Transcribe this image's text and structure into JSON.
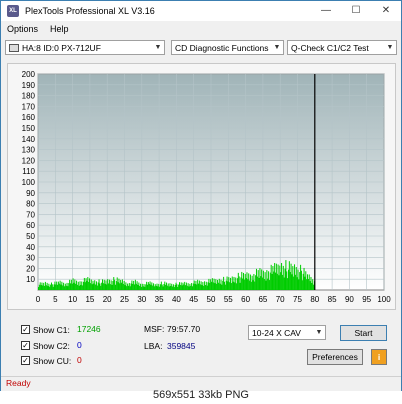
{
  "window": {
    "title": "PlexTools Professional XL V3.16",
    "icon_label": "XL",
    "controls": {
      "minimize": "—",
      "maximize": "☐",
      "close": "✕"
    }
  },
  "menu": {
    "options": "Options",
    "help": "Help"
  },
  "toolbar": {
    "drive": "HA:8 ID:0  PX-712UF",
    "function": "CD Diagnostic Functions",
    "test": "Q-Check C1/C2 Test"
  },
  "chart_data": {
    "type": "bar",
    "title": "",
    "xlabel": "",
    "ylabel": "",
    "xlim": [
      0,
      100
    ],
    "ylim": [
      0,
      200
    ],
    "x_ticks": [
      "0",
      "5",
      "10",
      "15",
      "20",
      "25",
      "30",
      "35",
      "40",
      "45",
      "50",
      "55",
      "60",
      "65",
      "70",
      "75",
      "80",
      "85",
      "90",
      "95",
      "100"
    ],
    "y_ticks": [
      "200",
      "190",
      "180",
      "170",
      "160",
      "150",
      "140",
      "130",
      "120",
      "110",
      "100",
      "90",
      "80",
      "70",
      "60",
      "50",
      "40",
      "30",
      "20",
      "10"
    ],
    "marker_x": 80,
    "colors": {
      "c1": "#00cc00",
      "marker": "#000000",
      "grid": "#b4c4c8",
      "plot_bg_top": "#a0b4b8",
      "plot_bg_bottom": "#ffffff"
    },
    "series": [
      {
        "name": "C1",
        "x": [
          0,
          2,
          4,
          6,
          8,
          10,
          12,
          14,
          16,
          18,
          20,
          22,
          24,
          26,
          28,
          30,
          32,
          34,
          36,
          38,
          40,
          42,
          44,
          46,
          48,
          50,
          52,
          54,
          56,
          58,
          60,
          62,
          64,
          66,
          68,
          70,
          72,
          74,
          76,
          78,
          80
        ],
        "values": [
          5,
          6,
          5,
          7,
          6,
          8,
          7,
          9,
          8,
          7,
          8,
          9,
          8,
          6,
          7,
          5,
          6,
          5,
          6,
          5,
          5,
          6,
          6,
          7,
          7,
          8,
          9,
          9,
          10,
          12,
          13,
          14,
          15,
          16,
          18,
          22,
          20,
          19,
          17,
          12,
          8
        ]
      }
    ]
  },
  "stats": {
    "c1_label": "Show C1:",
    "c1_value": "17246",
    "c1_color": "#00a000",
    "c2_label": "Show C2:",
    "c2_value": "0",
    "c2_color": "#0000c0",
    "cu_label": "Show CU:",
    "cu_value": "0",
    "cu_color": "#c00000",
    "msf_label": "MSF:",
    "msf_value": "79:57.70",
    "lba_label": "LBA:",
    "lba_value": "359845",
    "speed": "10-24 X CAV",
    "start_label": "Start",
    "preferences_label": "Preferences",
    "info_icon": "i"
  },
  "status": {
    "text": "Ready"
  },
  "caption": "569x551  33kb  PNG"
}
